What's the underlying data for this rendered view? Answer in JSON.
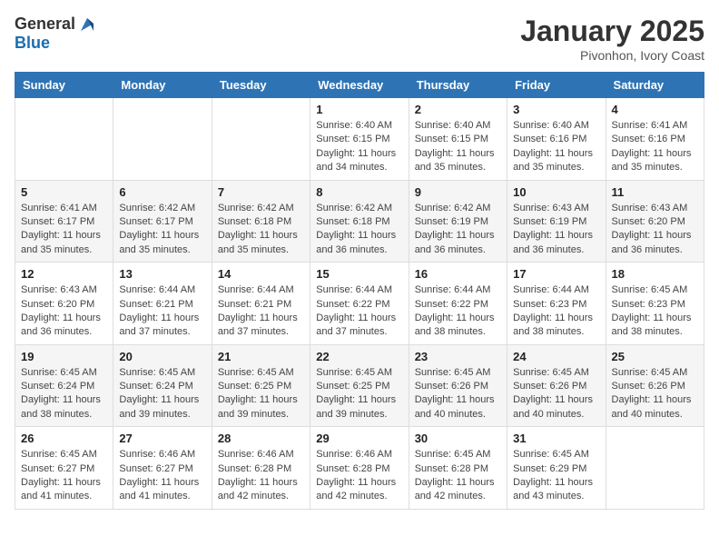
{
  "header": {
    "logo_general": "General",
    "logo_blue": "Blue",
    "month": "January 2025",
    "location": "Pivonhon, Ivory Coast"
  },
  "weekdays": [
    "Sunday",
    "Monday",
    "Tuesday",
    "Wednesday",
    "Thursday",
    "Friday",
    "Saturday"
  ],
  "weeks": [
    [
      {
        "day": "",
        "info": ""
      },
      {
        "day": "",
        "info": ""
      },
      {
        "day": "",
        "info": ""
      },
      {
        "day": "1",
        "sunrise": "Sunrise: 6:40 AM",
        "sunset": "Sunset: 6:15 PM",
        "daylight": "Daylight: 11 hours and 34 minutes."
      },
      {
        "day": "2",
        "sunrise": "Sunrise: 6:40 AM",
        "sunset": "Sunset: 6:15 PM",
        "daylight": "Daylight: 11 hours and 35 minutes."
      },
      {
        "day": "3",
        "sunrise": "Sunrise: 6:40 AM",
        "sunset": "Sunset: 6:16 PM",
        "daylight": "Daylight: 11 hours and 35 minutes."
      },
      {
        "day": "4",
        "sunrise": "Sunrise: 6:41 AM",
        "sunset": "Sunset: 6:16 PM",
        "daylight": "Daylight: 11 hours and 35 minutes."
      }
    ],
    [
      {
        "day": "5",
        "sunrise": "Sunrise: 6:41 AM",
        "sunset": "Sunset: 6:17 PM",
        "daylight": "Daylight: 11 hours and 35 minutes."
      },
      {
        "day": "6",
        "sunrise": "Sunrise: 6:42 AM",
        "sunset": "Sunset: 6:17 PM",
        "daylight": "Daylight: 11 hours and 35 minutes."
      },
      {
        "day": "7",
        "sunrise": "Sunrise: 6:42 AM",
        "sunset": "Sunset: 6:18 PM",
        "daylight": "Daylight: 11 hours and 35 minutes."
      },
      {
        "day": "8",
        "sunrise": "Sunrise: 6:42 AM",
        "sunset": "Sunset: 6:18 PM",
        "daylight": "Daylight: 11 hours and 36 minutes."
      },
      {
        "day": "9",
        "sunrise": "Sunrise: 6:42 AM",
        "sunset": "Sunset: 6:19 PM",
        "daylight": "Daylight: 11 hours and 36 minutes."
      },
      {
        "day": "10",
        "sunrise": "Sunrise: 6:43 AM",
        "sunset": "Sunset: 6:19 PM",
        "daylight": "Daylight: 11 hours and 36 minutes."
      },
      {
        "day": "11",
        "sunrise": "Sunrise: 6:43 AM",
        "sunset": "Sunset: 6:20 PM",
        "daylight": "Daylight: 11 hours and 36 minutes."
      }
    ],
    [
      {
        "day": "12",
        "sunrise": "Sunrise: 6:43 AM",
        "sunset": "Sunset: 6:20 PM",
        "daylight": "Daylight: 11 hours and 36 minutes."
      },
      {
        "day": "13",
        "sunrise": "Sunrise: 6:44 AM",
        "sunset": "Sunset: 6:21 PM",
        "daylight": "Daylight: 11 hours and 37 minutes."
      },
      {
        "day": "14",
        "sunrise": "Sunrise: 6:44 AM",
        "sunset": "Sunset: 6:21 PM",
        "daylight": "Daylight: 11 hours and 37 minutes."
      },
      {
        "day": "15",
        "sunrise": "Sunrise: 6:44 AM",
        "sunset": "Sunset: 6:22 PM",
        "daylight": "Daylight: 11 hours and 37 minutes."
      },
      {
        "day": "16",
        "sunrise": "Sunrise: 6:44 AM",
        "sunset": "Sunset: 6:22 PM",
        "daylight": "Daylight: 11 hours and 38 minutes."
      },
      {
        "day": "17",
        "sunrise": "Sunrise: 6:44 AM",
        "sunset": "Sunset: 6:23 PM",
        "daylight": "Daylight: 11 hours and 38 minutes."
      },
      {
        "day": "18",
        "sunrise": "Sunrise: 6:45 AM",
        "sunset": "Sunset: 6:23 PM",
        "daylight": "Daylight: 11 hours and 38 minutes."
      }
    ],
    [
      {
        "day": "19",
        "sunrise": "Sunrise: 6:45 AM",
        "sunset": "Sunset: 6:24 PM",
        "daylight": "Daylight: 11 hours and 38 minutes."
      },
      {
        "day": "20",
        "sunrise": "Sunrise: 6:45 AM",
        "sunset": "Sunset: 6:24 PM",
        "daylight": "Daylight: 11 hours and 39 minutes."
      },
      {
        "day": "21",
        "sunrise": "Sunrise: 6:45 AM",
        "sunset": "Sunset: 6:25 PM",
        "daylight": "Daylight: 11 hours and 39 minutes."
      },
      {
        "day": "22",
        "sunrise": "Sunrise: 6:45 AM",
        "sunset": "Sunset: 6:25 PM",
        "daylight": "Daylight: 11 hours and 39 minutes."
      },
      {
        "day": "23",
        "sunrise": "Sunrise: 6:45 AM",
        "sunset": "Sunset: 6:26 PM",
        "daylight": "Daylight: 11 hours and 40 minutes."
      },
      {
        "day": "24",
        "sunrise": "Sunrise: 6:45 AM",
        "sunset": "Sunset: 6:26 PM",
        "daylight": "Daylight: 11 hours and 40 minutes."
      },
      {
        "day": "25",
        "sunrise": "Sunrise: 6:45 AM",
        "sunset": "Sunset: 6:26 PM",
        "daylight": "Daylight: 11 hours and 40 minutes."
      }
    ],
    [
      {
        "day": "26",
        "sunrise": "Sunrise: 6:45 AM",
        "sunset": "Sunset: 6:27 PM",
        "daylight": "Daylight: 11 hours and 41 minutes."
      },
      {
        "day": "27",
        "sunrise": "Sunrise: 6:46 AM",
        "sunset": "Sunset: 6:27 PM",
        "daylight": "Daylight: 11 hours and 41 minutes."
      },
      {
        "day": "28",
        "sunrise": "Sunrise: 6:46 AM",
        "sunset": "Sunset: 6:28 PM",
        "daylight": "Daylight: 11 hours and 42 minutes."
      },
      {
        "day": "29",
        "sunrise": "Sunrise: 6:46 AM",
        "sunset": "Sunset: 6:28 PM",
        "daylight": "Daylight: 11 hours and 42 minutes."
      },
      {
        "day": "30",
        "sunrise": "Sunrise: 6:45 AM",
        "sunset": "Sunset: 6:28 PM",
        "daylight": "Daylight: 11 hours and 42 minutes."
      },
      {
        "day": "31",
        "sunrise": "Sunrise: 6:45 AM",
        "sunset": "Sunset: 6:29 PM",
        "daylight": "Daylight: 11 hours and 43 minutes."
      },
      {
        "day": "",
        "info": ""
      }
    ]
  ]
}
